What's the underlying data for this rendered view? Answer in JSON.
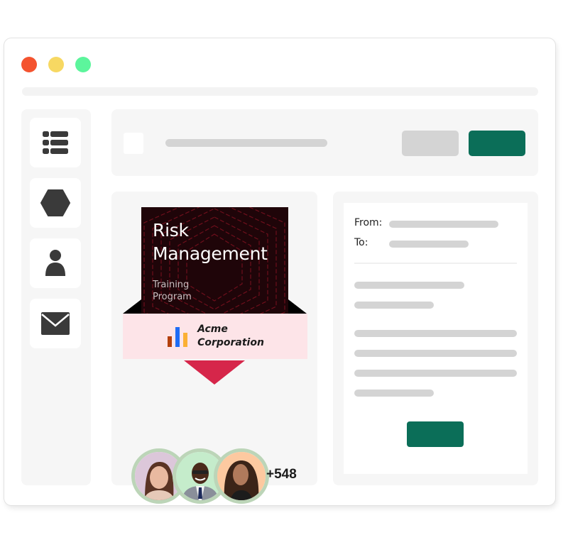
{
  "window": {
    "controls": [
      {
        "name": "close",
        "color": "#f4532f"
      },
      {
        "name": "minimize",
        "color": "#f7d862"
      },
      {
        "name": "maximize",
        "color": "#5cf59c"
      }
    ]
  },
  "sidebar": {
    "items": [
      {
        "icon": "list-icon"
      },
      {
        "icon": "hexagon-icon"
      },
      {
        "icon": "user-icon"
      },
      {
        "icon": "mail-icon"
      }
    ]
  },
  "toolbar": {
    "secondary_button_color": "#d4d4d4",
    "primary_button_color": "#0b6e58"
  },
  "course": {
    "title_line1": "Risk",
    "title_line2": "Management",
    "subtitle_line1": "Training",
    "subtitle_line2": "Program",
    "company_line1": "Acme",
    "company_line2": "Corporation",
    "accent_color": "#d6264a",
    "ribbon_color": "#fde4e8",
    "participants_extra": "+548",
    "avatars": [
      {
        "bg": "#dcc7da"
      },
      {
        "bg": "#c5eccb"
      },
      {
        "bg": "#fdc9a0"
      }
    ]
  },
  "email": {
    "from_label": "From:",
    "to_label": "To:",
    "send_button_color": "#0b6e58"
  }
}
